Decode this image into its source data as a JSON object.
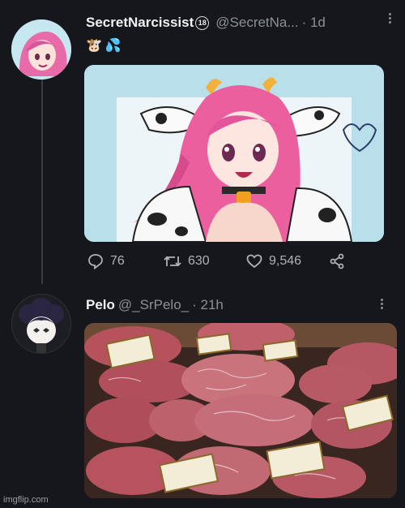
{
  "tweet1": {
    "display_name": "SecretNarcissist",
    "badge_text": "18",
    "handle": "@SecretNa...",
    "time": "· 1d",
    "emoji_cow": "🐮",
    "emoji_sweat": "💦",
    "stats": {
      "replies": "76",
      "retweets": "630",
      "likes": "9,546"
    }
  },
  "tweet2": {
    "display_name": "Pelo",
    "handle": "@_SrPelo_",
    "time": "· 21h"
  },
  "watermark": "imgflip.com",
  "colors": {
    "background": "#15171c",
    "thread_line": "#3a3f46",
    "muted": "#8b9097"
  }
}
